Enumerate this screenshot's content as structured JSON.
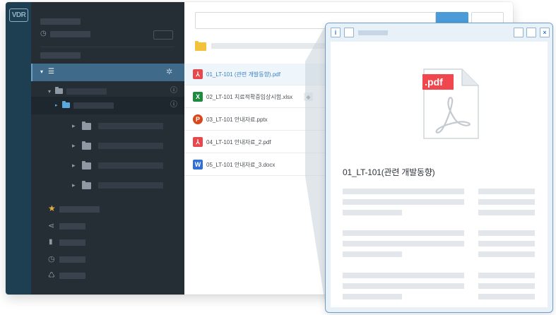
{
  "app": {
    "logo_text": "VDR",
    "accent_color": "#4a9bd8"
  },
  "sidebar": {
    "active_item_icon": "list-icon",
    "bottom_icons": [
      "star-icon",
      "share-icon",
      "file-icon",
      "clock-icon",
      "trash-icon"
    ]
  },
  "files": [
    {
      "name": "01_LT-101 (관련 개발동향).pdf",
      "type": "pdf",
      "icon_label": "⅄",
      "color": "#e8474c",
      "selected": true
    },
    {
      "name": "02_LT-101 치료적확증임상시험.xlsx",
      "type": "xlsx",
      "icon_label": "X",
      "color": "#1f8b3e",
      "selected": false,
      "tagged": true
    },
    {
      "name": "03_LT-101 안내자료.pptx",
      "type": "pptx",
      "icon_label": "P",
      "color": "#d9471c",
      "selected": false
    },
    {
      "name": "04_LT-101 안내자료_2.pdf",
      "type": "pdf",
      "icon_label": "⅄",
      "color": "#e8474c",
      "selected": false
    },
    {
      "name": "05_LT-101 안내자료_3.docx",
      "type": "docx",
      "icon_label": "W",
      "color": "#2f6fd6",
      "selected": false
    }
  ],
  "preview": {
    "info_label": "i",
    "close_label": "×",
    "badge": ".pdf",
    "badge_color": "#f0474f",
    "title": "01_LT-101(관련 개발동향)"
  }
}
